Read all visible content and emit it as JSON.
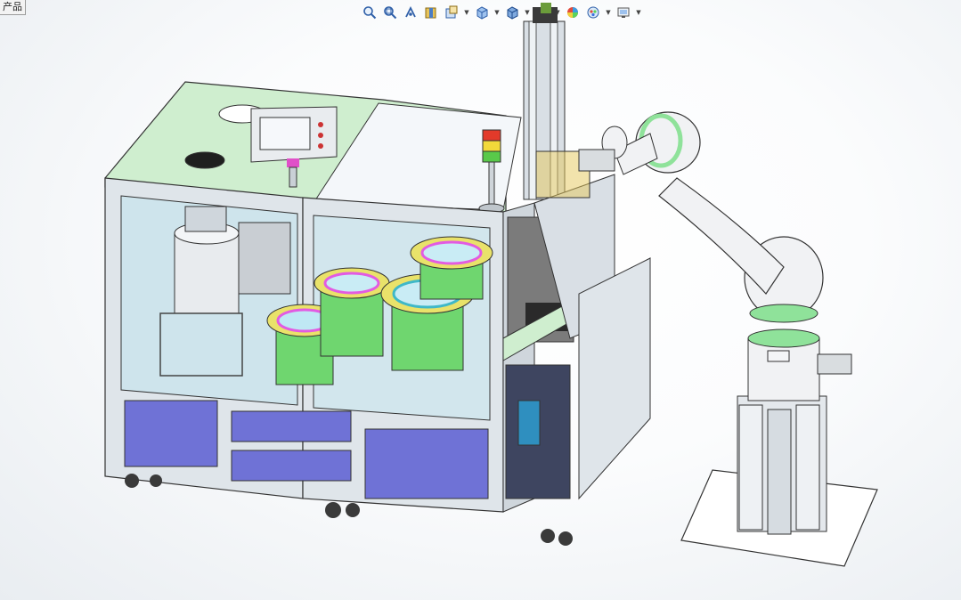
{
  "window": {
    "tab_label": "产品"
  },
  "toolbar": {
    "buttons": [
      {
        "icon": "zoom-to-fit-icon",
        "has_menu": false
      },
      {
        "icon": "zoom-to-area-icon",
        "has_menu": false
      },
      {
        "icon": "previous-view-icon",
        "has_menu": false
      },
      {
        "icon": "section-view-icon",
        "has_menu": false
      },
      {
        "icon": "dynamic-annotation-views-icon",
        "has_menu": true
      },
      {
        "icon": "view-orientation-icon",
        "has_menu": true
      },
      {
        "icon": "display-style-icon",
        "has_menu": true
      },
      {
        "icon": "hide-show-items-icon",
        "has_menu": true
      },
      {
        "icon": "edit-appearance-icon",
        "has_menu": true
      },
      {
        "icon": "apply-scene-icon",
        "has_menu": true
      },
      {
        "icon": "view-settings-icon",
        "has_menu": true
      }
    ]
  },
  "colors": {
    "frame_green": "#cfeecf",
    "aluminium": "#dfe5ea",
    "panel_blue": "#6f72d6",
    "bowl_green": "#6fd66f",
    "bowl_yellow": "#e9e26a",
    "bowl_magenta": "#e25be2",
    "robot_white": "#f1f2f4",
    "robot_green_ring": "#8fe29a"
  }
}
